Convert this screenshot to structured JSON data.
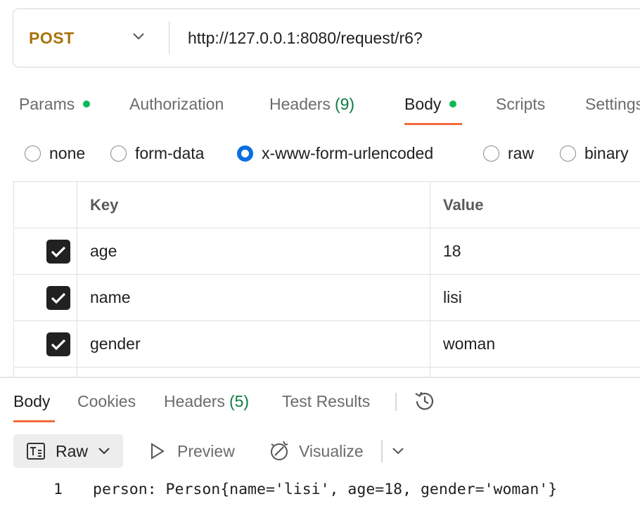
{
  "request": {
    "method": "POST",
    "url": "http://127.0.0.1:8080/request/r6?"
  },
  "tabs": [
    {
      "label": "Params",
      "dot": true
    },
    {
      "label": "Authorization"
    },
    {
      "label": "Headers",
      "count": "(9)"
    },
    {
      "label": "Body",
      "dot": true,
      "active": true
    },
    {
      "label": "Scripts"
    },
    {
      "label": "Settings"
    }
  ],
  "body_types": [
    {
      "label": "none",
      "selected": false
    },
    {
      "label": "form-data",
      "selected": false
    },
    {
      "label": "x-www-form-urlencoded",
      "selected": true
    },
    {
      "label": "raw",
      "selected": false
    },
    {
      "label": "binary",
      "selected": false
    }
  ],
  "table": {
    "headers": {
      "key": "Key",
      "value": "Value"
    },
    "rows": [
      {
        "key": "age",
        "value": "18",
        "checked": true
      },
      {
        "key": "name",
        "value": "lisi",
        "checked": true
      },
      {
        "key": "gender",
        "value": "woman",
        "checked": true
      }
    ]
  },
  "response": {
    "tabs": [
      {
        "label": "Body",
        "active": true
      },
      {
        "label": "Cookies"
      },
      {
        "label": "Headers",
        "count": "(5)"
      },
      {
        "label": "Test Results"
      }
    ],
    "toolbar": {
      "raw_label": "Raw",
      "preview_label": "Preview",
      "visualize_label": "Visualize"
    },
    "lines": [
      {
        "number": "1",
        "text": "person: Person{name='lisi', age=18, gender='woman'}"
      }
    ]
  },
  "colors": {
    "method": "#a9740c",
    "active_underline": "#f26b3a",
    "status_dot": "#0cbb52",
    "count_text": "#0f7b43",
    "radio_selected": "#0a6ee0"
  }
}
